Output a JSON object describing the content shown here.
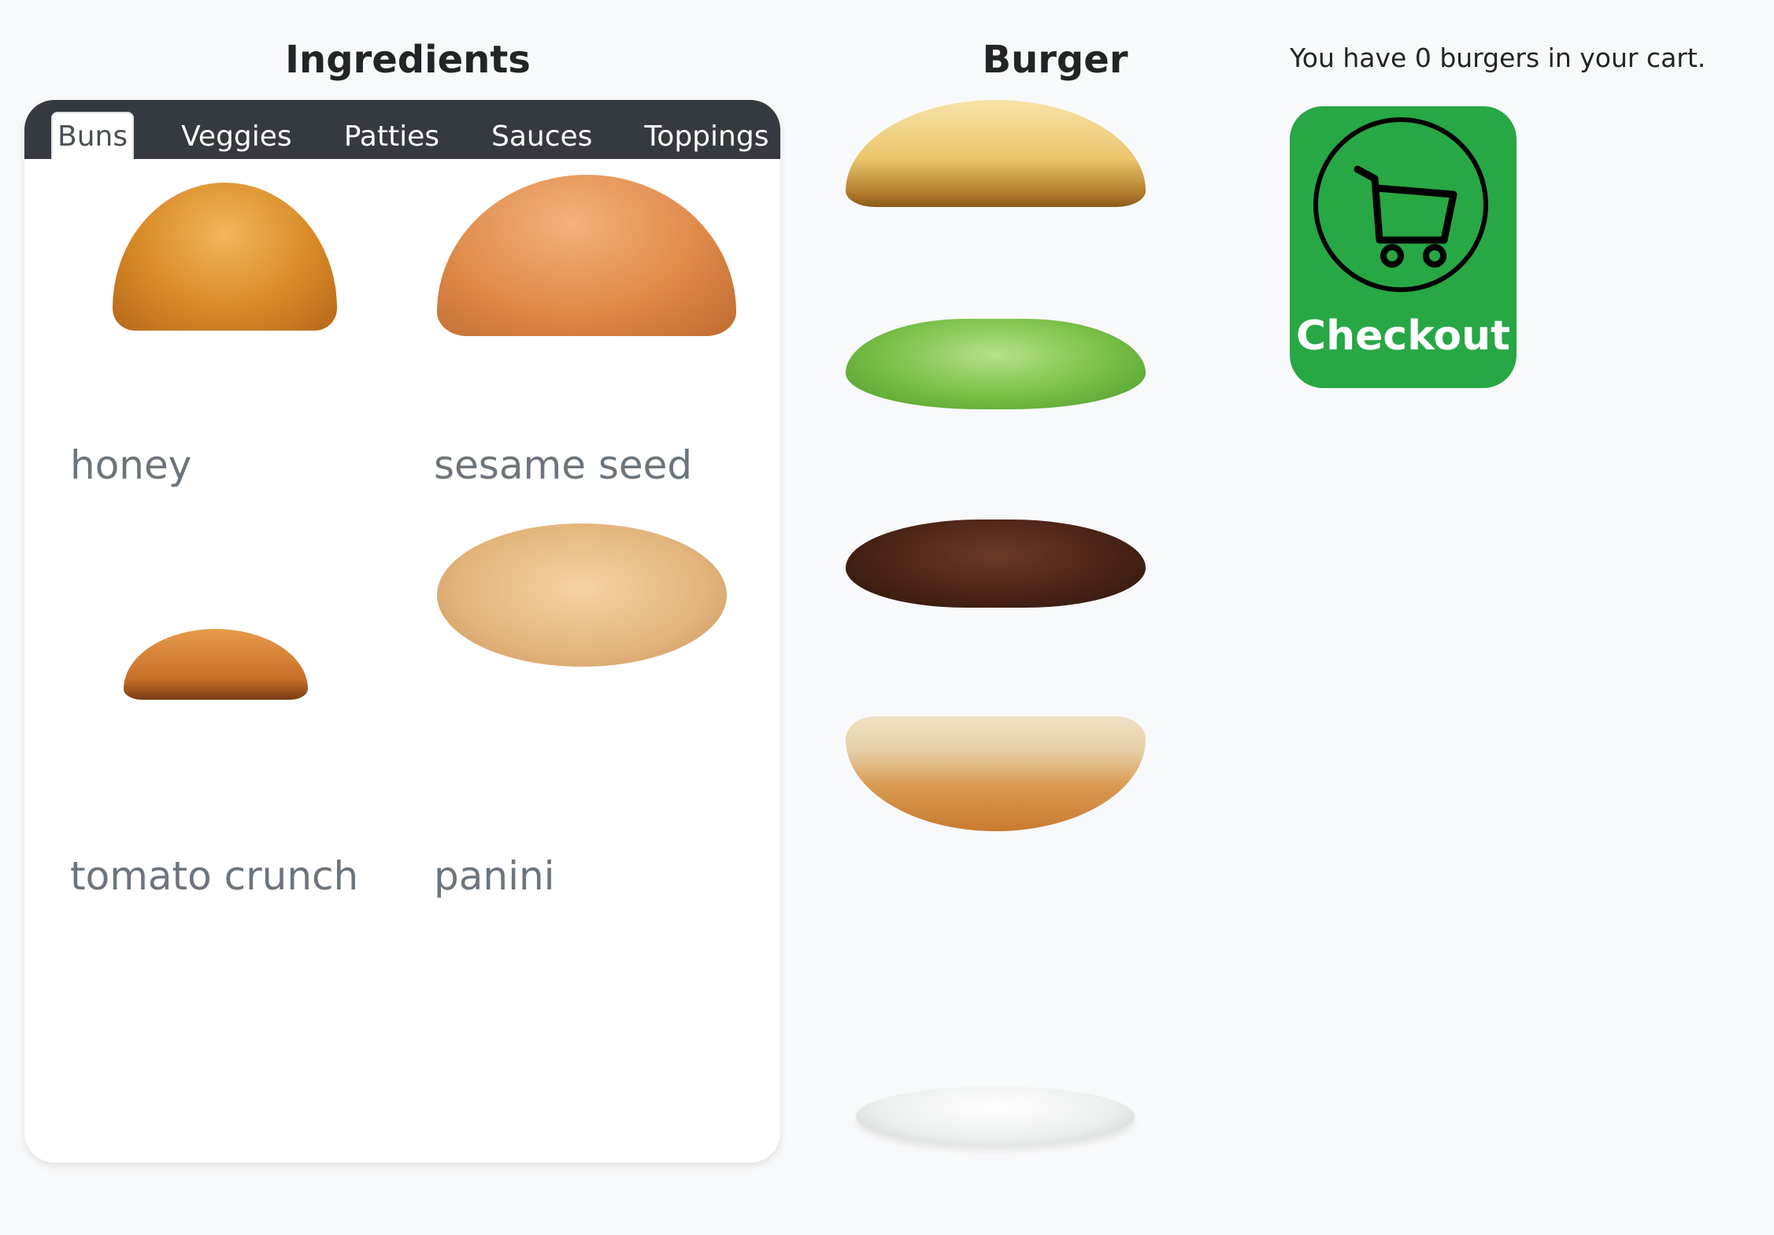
{
  "ingredients": {
    "title": "Ingredients",
    "tabs": [
      "Buns",
      "Veggies",
      "Patties",
      "Sauces",
      "Toppings"
    ],
    "active_tab": "Buns",
    "items": [
      {
        "label": "honey",
        "image": "honey-bun"
      },
      {
        "label": "sesame seed",
        "image": "sesame-seed-bun"
      },
      {
        "label": "tomato crunch",
        "image": "tomato-crunch-bun"
      },
      {
        "label": "panini",
        "image": "panini-bun"
      }
    ]
  },
  "burger": {
    "title": "Burger",
    "layers": [
      "top-bun",
      "lettuce",
      "beef-patty",
      "bottom-bun",
      "plate"
    ]
  },
  "cart": {
    "text": "You have 0 burgers in your cart.",
    "checkout_label": "Checkout",
    "checkout_icon": "shopping-cart-icon"
  },
  "colors": {
    "tabbar": "#343a40",
    "checkout": "#28a745",
    "label": "#6c757d",
    "background": "#f8f9fa"
  }
}
